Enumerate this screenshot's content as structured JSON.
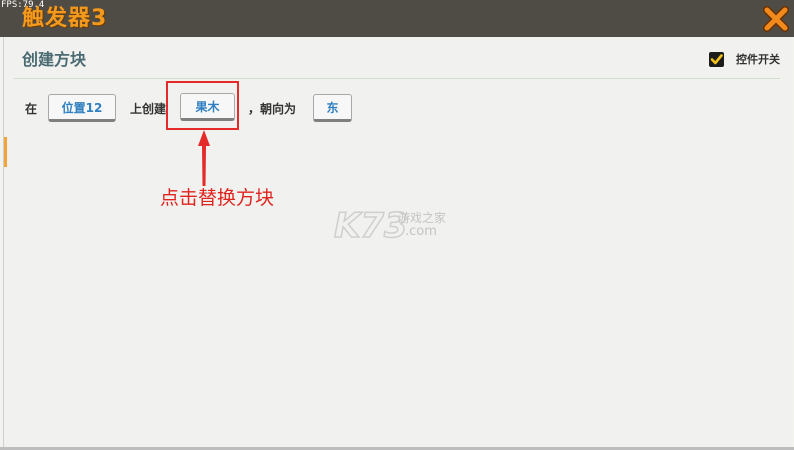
{
  "window": {
    "fps": "FPS:79.4",
    "title": "触发器3"
  },
  "panel": {
    "section_title": "创建方块",
    "toggle_label": "控件开关",
    "toggle_checked": true
  },
  "action_row": {
    "prefix": "在",
    "position_button": "位置12",
    "middle_text": "上创建",
    "block_button": "果木",
    "facing_text": "，朝向为",
    "direction_button": "东"
  },
  "annotation": {
    "text": "点击替换方块",
    "color": "#e0251f"
  },
  "watermark": {
    "logo": "K73",
    "site_name": "游戏之家",
    "domain": ".com"
  },
  "colors": {
    "title_orange": "#f39a1e",
    "titlebar": "#4f4b45",
    "button_text_blue": "#2f7fc1",
    "section_title": "#4a6b72",
    "highlight_red": "#e52a2a"
  },
  "icons": {
    "close": "close-x-icon",
    "checkbox": "checkmark-icon"
  }
}
